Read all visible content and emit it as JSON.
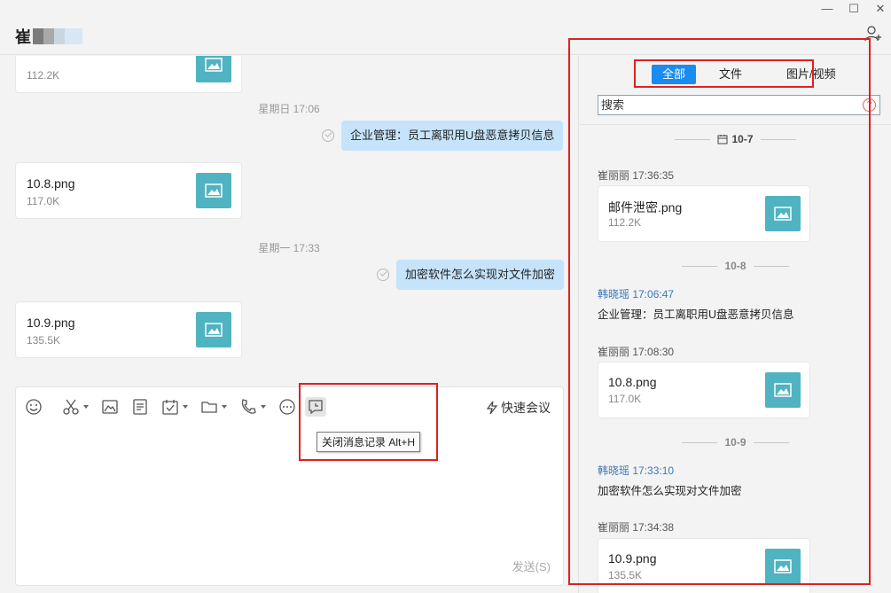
{
  "header": {
    "title_char": "崔"
  },
  "chat": {
    "messages": [
      {
        "type": "file",
        "size": "112.2K"
      },
      {
        "type": "timestamp",
        "text": "星期日 17:06"
      },
      {
        "type": "outgoing",
        "text": "企业管理：员工离职用U盘恶意拷贝信息"
      },
      {
        "type": "file",
        "name": "10.8.png",
        "size": "117.0K"
      },
      {
        "type": "timestamp",
        "text": "星期一 17:33"
      },
      {
        "type": "outgoing",
        "text": "加密软件怎么实现对文件加密"
      },
      {
        "type": "file",
        "name": "10.9.png",
        "size": "135.5K"
      }
    ]
  },
  "toolbar": {
    "quick_meeting": "快速会议",
    "tooltip": "关闭消息记录 Alt+H",
    "send": "发送(S)"
  },
  "panel": {
    "tabs": [
      "全部",
      "文件",
      "图片/视频"
    ],
    "search_placeholder": "搜索",
    "groups": [
      {
        "date": "10-7",
        "items": [
          {
            "sender": "崔丽丽 17:36:35",
            "sender_color": "#555555",
            "kind": "file",
            "name": "邮件泄密.png",
            "size": "112.2K"
          }
        ]
      },
      {
        "date": "10-8",
        "items": [
          {
            "sender": "韩晓瑶 17:06:47",
            "sender_color": "#3e78b8",
            "kind": "text",
            "text": "企业管理：员工离职用U盘恶意拷贝信息"
          },
          {
            "sender": "崔丽丽 17:08:30",
            "sender_color": "#555555",
            "kind": "file",
            "name": "10.8.png",
            "size": "117.0K"
          }
        ]
      },
      {
        "date": "10-9",
        "items": [
          {
            "sender": "韩晓瑶 17:33:10",
            "sender_color": "#3e78b8",
            "kind": "text",
            "text": "加密软件怎么实现对文件加密"
          },
          {
            "sender": "崔丽丽 17:34:38",
            "sender_color": "#555555",
            "kind": "file",
            "name": "10.9.png",
            "size": "135.5K"
          }
        ]
      }
    ]
  },
  "colors": {
    "accent": "#1a8cf0",
    "bubble": "#c5e4fb",
    "thumb": "#4fb3c1",
    "highlight": "#e02020"
  }
}
